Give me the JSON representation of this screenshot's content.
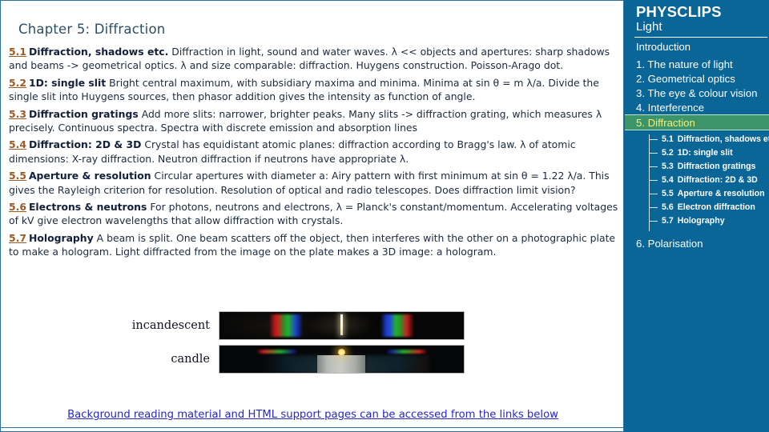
{
  "page": {
    "title": "Chapter 5: Diffraction"
  },
  "sections": [
    {
      "num": "5.1",
      "head": "Diffraction, shadows etc.",
      "body": "Diffraction in light, sound and water waves. λ << objects and apertures: sharp shadows and beams -> geometrical optics. λ and size comparable: diffraction. Huygens construction. Poisson-Arago dot."
    },
    {
      "num": "5.2",
      "head": "1D: single slit",
      "body": "Bright central maximum, with subsidiary maxima and minima. Minima at sin θ = m λ/a.  Divide the single slit into Huygens sources, then phasor addition gives the intensity as function of angle."
    },
    {
      "num": "5.3",
      "head": "Diffraction gratings",
      "body": "Add more slits: narrower, brighter peaks. Many slits -> diffraction grating, which measures λ precisely. Continuous spectra. Spectra with discrete emission and absorption lines"
    },
    {
      "num": "5.4",
      "head": "Diffraction: 2D & 3D",
      "body": "Crystal has equidistant atomic planes: diffraction according to Bragg's law. λ of atomic dimensions: X-ray diffraction. Neutron diffraction if neutrons have appropriate λ."
    },
    {
      "num": "5.5",
      "head": "Aperture & resolution",
      "body": "Circular apertures with diameter a: Airy pattern with first minimum at sin θ = 1.22 λ/a. This gives the Rayleigh criterion for resolution. Resolution of optical and radio telescopes. Does diffraction limit vision?"
    },
    {
      "num": "5.6",
      "head": "Electrons & neutrons",
      "body": "For photons, neutrons and electrons, λ = Planck's constant/momentum. Accelerating voltages of kV give electron wavelengths that allow diffraction with crystals."
    },
    {
      "num": "5.7",
      "head": "Holography",
      "body": "A beam is split. One beam scatters off the object, then interferes with the other on a photographic plate to make a hologram. Light diffracted from the image on the plate makes a 3D image: a hologram."
    }
  ],
  "photos": [
    {
      "label": "incandescent"
    },
    {
      "label": "candle"
    }
  ],
  "bottom": {
    "link": "Background reading material and HTML support pages can be accessed from the links below"
  },
  "sidebar": {
    "brand": "PHYSCLIPS",
    "brand_sub": "Light",
    "items": [
      {
        "label": "Introduction",
        "active": false
      },
      {
        "label": "1. The nature of light",
        "active": false
      },
      {
        "label": "2. Geometrical optics",
        "active": false
      },
      {
        "label": "3. The eye & colour vision",
        "active": false
      },
      {
        "label": "4. Interference",
        "active": false
      },
      {
        "label": "5. Diffraction",
        "active": true
      }
    ],
    "subitems": [
      {
        "num": "5.1",
        "label": "Diffraction, shadows etc"
      },
      {
        "num": "5.2",
        "label": "1D: single slit"
      },
      {
        "num": "5.3",
        "label": "Diffraction gratings"
      },
      {
        "num": "5.4",
        "label": "Diffraction: 2D & 3D"
      },
      {
        "num": "5.5",
        "label": "Aperture & resolution"
      },
      {
        "num": "5.6",
        "label": "Electron diffraction"
      },
      {
        "num": "5.7",
        "label": "Holography"
      }
    ],
    "last_item": {
      "label": "6. Polarisation"
    }
  },
  "colors": {
    "sidebar_bg": "#0a6697",
    "active_bg": "#3c9468",
    "active_text": "#f2f07a",
    "link": "#2727c8",
    "sec_num": "#9c5a26"
  }
}
